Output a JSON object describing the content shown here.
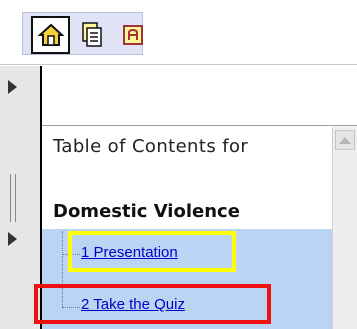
{
  "toolbar": {
    "buttons": [
      {
        "icon": "home-icon"
      },
      {
        "icon": "document-icon"
      },
      {
        "icon": "text-icon"
      }
    ]
  },
  "toc": {
    "title": "Table of Contents for",
    "course": "Domestic Violence",
    "items": [
      {
        "label": "1 Presentation"
      },
      {
        "label": "2 Take the Quiz"
      }
    ]
  },
  "colors": {
    "highlight_yellow": "#ffff00",
    "highlight_red": "#ee1111",
    "link": "#0000c8",
    "list_bg": "#bcd4f3"
  }
}
